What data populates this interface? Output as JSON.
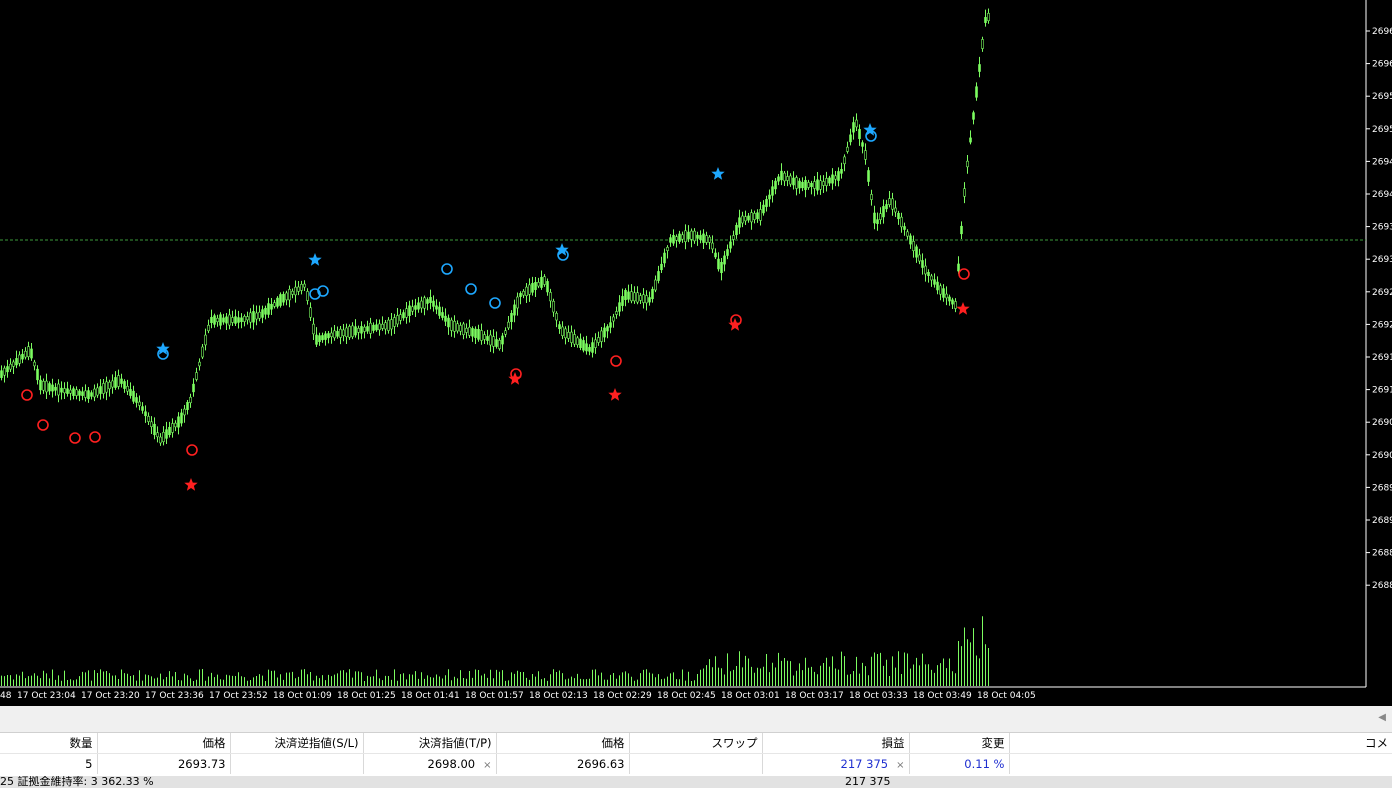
{
  "chart": {
    "price_axis_labels": [
      "2696",
      "2696",
      "2695",
      "2695",
      "2694",
      "2694",
      "2693",
      "2693",
      "2692",
      "2692",
      "2691",
      "2691",
      "2690",
      "2690",
      "2689",
      "2689",
      "2688",
      "2688"
    ],
    "time_axis_labels": [
      "48",
      "17 Oct 23:04",
      "17 Oct 23:20",
      "17 Oct 23:36",
      "17 Oct 23:52",
      "18 Oct 01:09",
      "18 Oct 01:25",
      "18 Oct 01:41",
      "18 Oct 01:57",
      "18 Oct 02:13",
      "18 Oct 02:29",
      "18 Oct 02:45",
      "18 Oct 03:01",
      "18 Oct 03:17",
      "18 Oct 03:33",
      "18 Oct 03:49",
      "18 Oct 04:05"
    ],
    "colors": {
      "candle": "#7CFC60",
      "buy_signal": "#1EA8FF",
      "sell_signal": "#FF2020",
      "price_line": "#3a9a3a",
      "axis": "#ffffff"
    }
  },
  "positions_table": {
    "headers": [
      "数量",
      "価格",
      "決済逆指値(S/L)",
      "決済指値(T/P)",
      "価格",
      "スワップ",
      "損益",
      "変更",
      "コメ"
    ],
    "rows": [
      {
        "volume": "5",
        "open_price": "2693.73",
        "sl": "",
        "tp": "2698.00",
        "current_price": "2696.63",
        "swap": "",
        "profit": "217 375",
        "change": "0.11 %",
        "comment": ""
      }
    ],
    "close_symbol": "×"
  },
  "summary": {
    "left_text": "25  証拠金維持率: 3 362.33 %",
    "profit_total": "217 375"
  }
}
